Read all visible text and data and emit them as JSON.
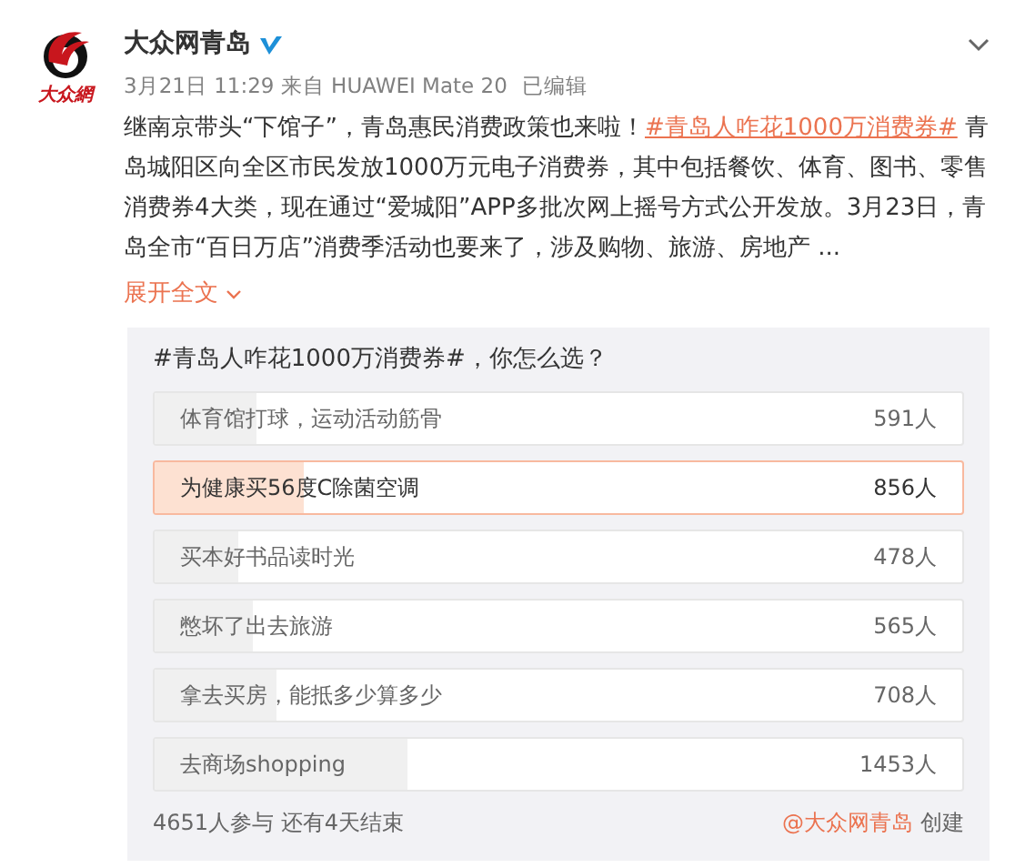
{
  "post": {
    "logo_text": "大众網",
    "author": "大众网青岛",
    "verified": true,
    "meta": "3月21日 11:29 来自 HUAWEI Mate 20",
    "edited": "已编辑",
    "text_before": "继南京带头“下馆子”，青岛惠民消费政策也来啦！",
    "hashtag": "#青岛人咋花1000万消费券#",
    "text_after": " 青岛城阳区向全区市民发放1000万元电子消费券，其中包括餐饮、体育、图书、零售消费券4大类，现在通过“爱城阳”APP多批次网上摇号方式公开发放。3月23日，青岛全市“百日万店”消费季活动也要来了，涉及购物、旅游、房地产 ...",
    "expand": "展开全文"
  },
  "poll": {
    "title": "#青岛人咋花1000万消费券#，你怎么选？",
    "options": [
      {
        "label": "体育馆打球，运动活动筋骨",
        "count": "591人",
        "level": 0.127,
        "selected": false
      },
      {
        "label": "为健康买56度C除菌空调",
        "count": "856人",
        "level": 0.184,
        "selected": true
      },
      {
        "label": "买本好书品读时光",
        "count": "478人",
        "level": 0.103,
        "selected": false
      },
      {
        "label": "憋坏了出去旅游",
        "count": "565人",
        "level": 0.121,
        "selected": false
      },
      {
        "label": "拿去买房，能抵多少算多少",
        "count": "708人",
        "level": 0.152,
        "selected": false
      },
      {
        "label": "去商场shopping",
        "count": "1453人",
        "level": 0.312,
        "selected": false
      }
    ],
    "summary": "4651人参与 还有4天结束",
    "creator": "@大众网青岛",
    "created": "创建"
  }
}
